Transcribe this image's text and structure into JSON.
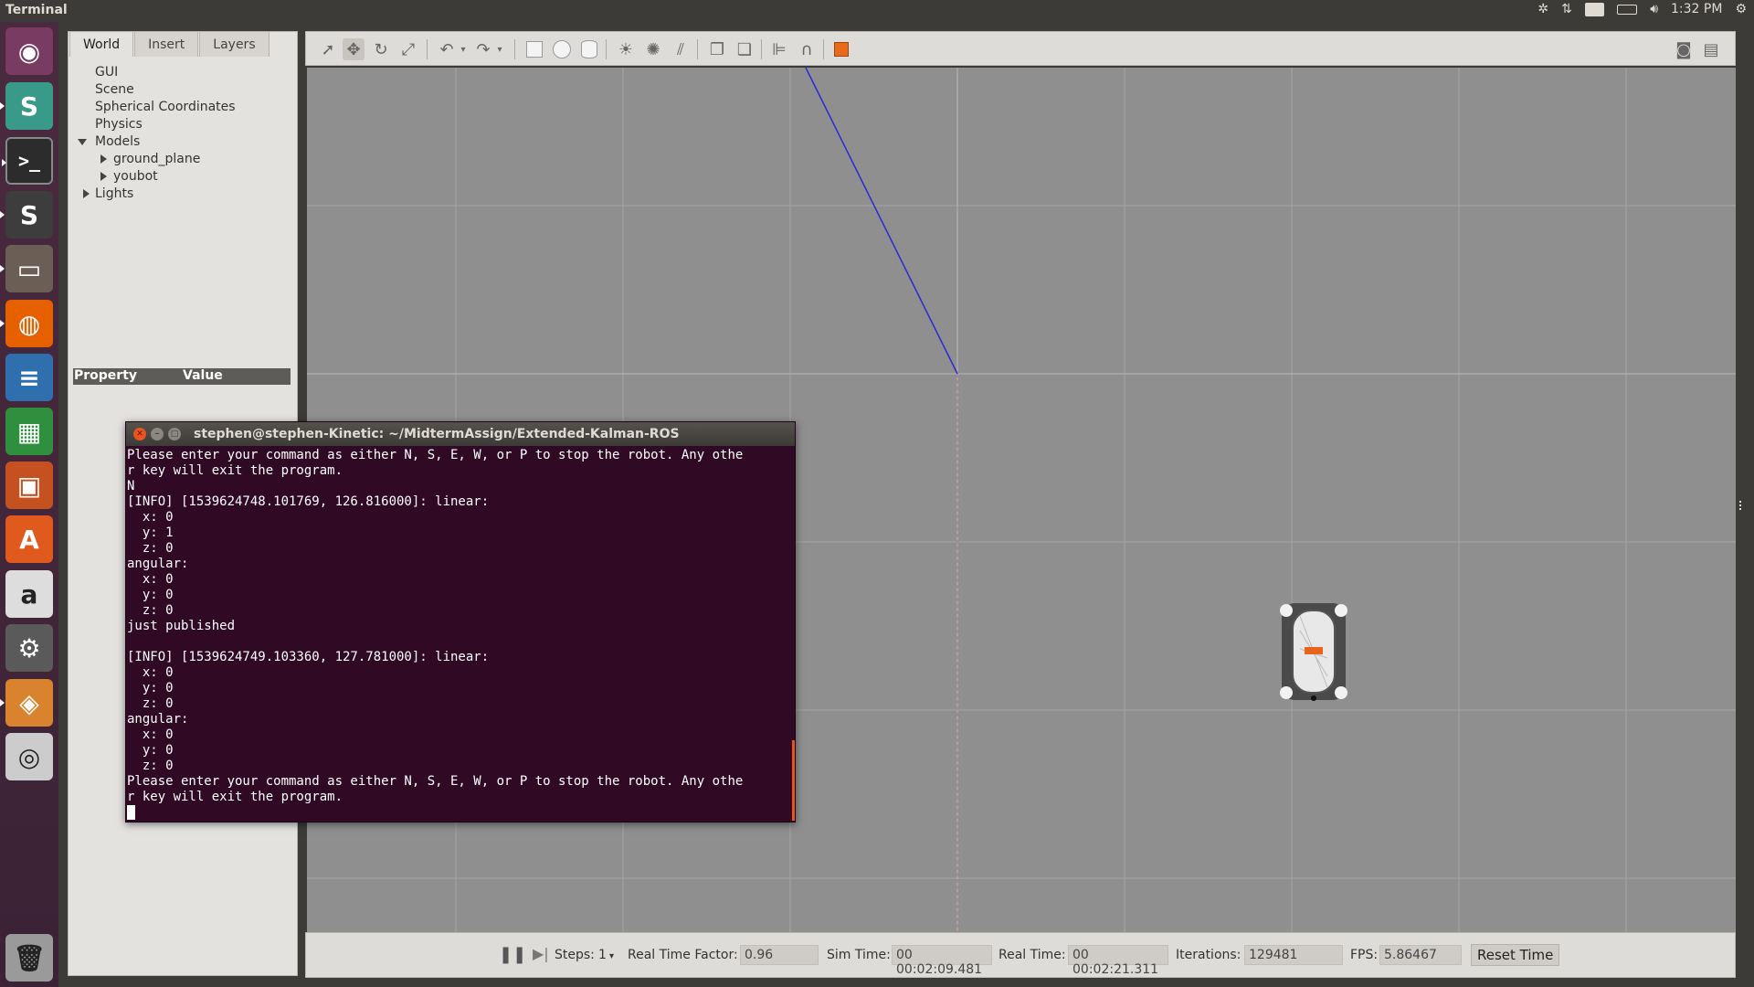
{
  "top_panel": {
    "app_title": "Terminal",
    "keyboard_layout": "En",
    "clock": "1:32 PM"
  },
  "launcher": {
    "items": [
      {
        "icon": "ubuntu-dash-icon",
        "color": "#7a3b63"
      },
      {
        "icon": "slack-icon",
        "color": "#3a9a8a"
      },
      {
        "icon": "terminal-icon",
        "color": "#2c2c2c"
      },
      {
        "icon": "sublime-text-icon",
        "color": "#3d3d3d"
      },
      {
        "icon": "files-icon",
        "color": "#6b5e55"
      },
      {
        "icon": "firefox-icon",
        "color": "#e66000"
      },
      {
        "icon": "libreoffice-writer-icon",
        "color": "#2f6fad"
      },
      {
        "icon": "libreoffice-calc-icon",
        "color": "#2f8f3f"
      },
      {
        "icon": "libreoffice-impress-icon",
        "color": "#c4511f"
      },
      {
        "icon": "software-center-icon",
        "color": "#e05a1e"
      },
      {
        "icon": "amazon-icon",
        "color": "#dddddd"
      },
      {
        "icon": "system-settings-icon",
        "color": "#5a5a5a"
      },
      {
        "icon": "gazebo-icon",
        "color": "#d9832f"
      },
      {
        "icon": "dvd-icon",
        "color": "#cccccc"
      },
      {
        "icon": "trash-icon",
        "color": "#9a9a9a"
      }
    ]
  },
  "left_panel": {
    "tabs": [
      "World",
      "Insert",
      "Layers"
    ],
    "tree": {
      "gui": "GUI",
      "scene": "Scene",
      "spherical": "Spherical Coordinates",
      "physics": "Physics",
      "models": "Models",
      "ground_plane": "ground_plane",
      "youbot": "youbot",
      "lights": "Lights"
    },
    "property_header": "Property",
    "value_header": "Value"
  },
  "terminal": {
    "title": "stephen@stephen-Kinetic: ~/MidtermAssign/Extended-Kalman-ROS",
    "lines": [
      "Please enter your command as either N, S, E, W, or P to stop the robot. Any othe",
      "r key will exit the program.",
      "N",
      "[INFO] [1539624748.101769, 126.816000]: linear:",
      "  x: 0",
      "  y: 1",
      "  z: 0",
      "angular:",
      "  x: 0",
      "  y: 0",
      "  z: 0",
      "just published",
      "",
      "[INFO] [1539624749.103360, 127.781000]: linear:",
      "  x: 0",
      "  y: 0",
      "  z: 0",
      "angular:",
      "  x: 0",
      "  y: 0",
      "  z: 0",
      "Please enter your command as either N, S, E, W, or P to stop the robot. Any othe",
      "r key will exit the program."
    ]
  },
  "bottom_bar": {
    "steps_label": "Steps:",
    "steps_value": "1",
    "rtf_label": "Real Time Factor:",
    "rtf_value": "0.96",
    "sim_time_label": "Sim Time:",
    "sim_time_value": "00 00:02:09.481",
    "real_time_label": "Real Time:",
    "real_time_value": "00 00:02:21.311",
    "iterations_label": "Iterations:",
    "iterations_value": "129481",
    "fps_label": "FPS:",
    "fps_value": "5.86467",
    "reset_label": "Reset Time"
  },
  "colors": {
    "terminal_bg": "#300a24",
    "viewport_bg": "#8f8f8f",
    "accent_orange": "#e95420",
    "axis_blue": "#2a2ad8"
  }
}
